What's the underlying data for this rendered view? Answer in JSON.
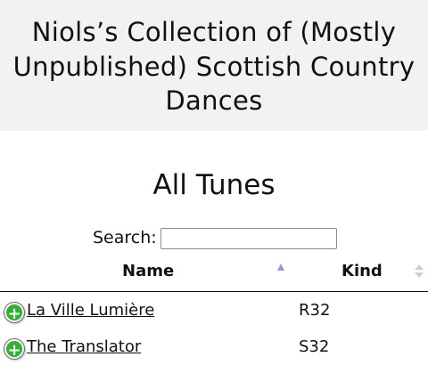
{
  "header": {
    "site_title": "Niols’s Collection of (Mostly Unpublished) Scottish Country Dances"
  },
  "page": {
    "title": "All Tunes"
  },
  "search": {
    "label": "Search:",
    "value": "",
    "placeholder": ""
  },
  "table": {
    "columns": {
      "name": "Name",
      "kind": "Kind"
    },
    "sort": {
      "column": "Name",
      "direction": "ascending"
    },
    "rows": [
      {
        "name": "La Ville Lumière",
        "kind": "R32"
      },
      {
        "name": "The Translator",
        "kind": "S32"
      }
    ]
  },
  "icons": {
    "expand": "plus-circle-icon",
    "expand_glyph": "+"
  },
  "colors": {
    "header_bg": "#f2f2f2",
    "expand_green": "#31b131",
    "sort_active": "#8a9be0",
    "sort_inactive": "#cfcfcf"
  }
}
